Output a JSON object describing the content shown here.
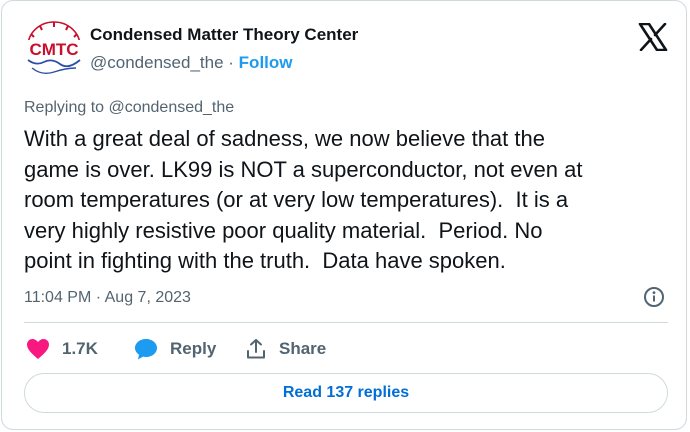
{
  "author": {
    "avatar_text": "CMTC",
    "name": "Condensed Matter Theory Center",
    "handle": "@condensed_the",
    "separator": "·",
    "follow_label": "Follow"
  },
  "reply_context": "Replying to @condensed_the",
  "tweet": {
    "lines": [
      "With a great deal of sadness, we now believe that the",
      "game is over. LK99 is NOT a superconductor, not even at",
      "room temperatures (or at very low temperatures).  It is a",
      "very highly resistive poor quality material.  Period. No",
      "point in fighting with the truth.  Data have spoken."
    ],
    "timestamp": "11:04 PM · Aug 7, 2023"
  },
  "actions": {
    "like_count": "1.7K",
    "reply_label": "Reply",
    "share_label": "Share"
  },
  "read_replies_label": "Read 137 replies",
  "colors": {
    "heart": "#f91880",
    "reply_bubble": "#1d9bf0",
    "link": "#1d9bf0",
    "button_text": "#006fd6",
    "avatar_red": "#c8102e",
    "avatar_blue": "#2b4fa8"
  },
  "icons": {
    "logo": "x-logo-icon",
    "info": "info-icon",
    "like": "heart-icon",
    "reply": "reply-bubble-icon",
    "share": "share-icon"
  }
}
